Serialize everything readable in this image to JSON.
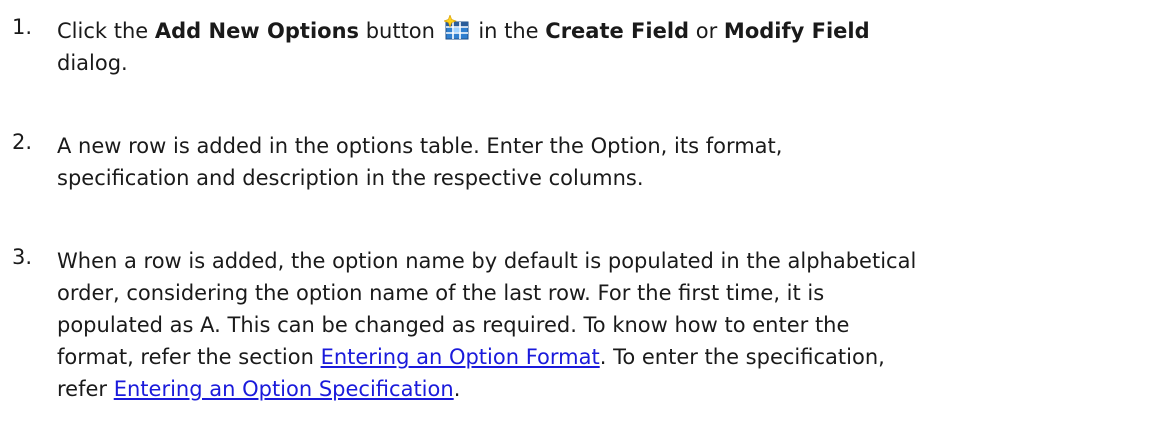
{
  "steps": [
    {
      "number": "1.",
      "l1": {
        "t1": "Click the ",
        "b1": "Add New Options",
        "t2": " button ",
        "icon": "add-new-options-icon",
        "t3": " in the ",
        "b2": "Create Field",
        "t4": " or ",
        "b3": "Modify Field"
      },
      "l2": "dialog."
    },
    {
      "number": "2.",
      "l1": "A new row is added in the options table. Enter the Option, its format,",
      "l2": "specification and description in the respective columns."
    },
    {
      "number": "3.",
      "l1": "When a row is added, the option name by default is populated in the alphabetical",
      "l2": "order, considering the option name of the last row. For the first time, it is",
      "l3": "populated as A. This can be changed as required. To know how to enter the",
      "l4": {
        "t1": "format, refer the section ",
        "link": "Entering an Option Format",
        "t2": ". To enter the specification,"
      },
      "l5": {
        "t1": "refer ",
        "link": "Entering an Option Specification",
        "t2": "."
      }
    }
  ],
  "colors": {
    "text": "#1a1a1a",
    "link": "#1a1adb",
    "background": "#ffffff"
  }
}
